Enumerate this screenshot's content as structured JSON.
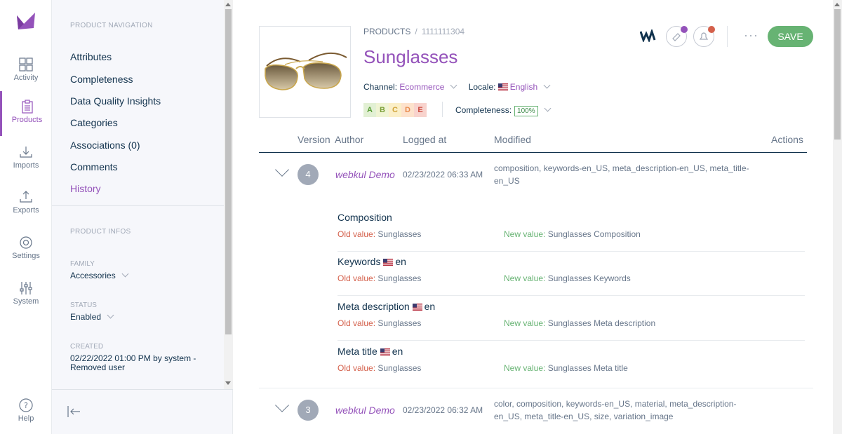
{
  "rail": {
    "items": [
      {
        "label": "Activity",
        "icon": "dashboard-icon"
      },
      {
        "label": "Products",
        "icon": "clipboard-icon"
      },
      {
        "label": "Imports",
        "icon": "import-icon"
      },
      {
        "label": "Exports",
        "icon": "export-icon"
      },
      {
        "label": "Settings",
        "icon": "gear-icon"
      },
      {
        "label": "System",
        "icon": "sliders-icon"
      }
    ],
    "help_label": "Help"
  },
  "product_nav": {
    "title": "PRODUCT NAVIGATION",
    "links": [
      "Attributes",
      "Completeness",
      "Data Quality Insights",
      "Categories",
      "Associations (0)",
      "Comments",
      "History"
    ],
    "active": "History",
    "infos_title": "PRODUCT INFOS",
    "family_label": "FAMILY",
    "family_value": "Accessories",
    "status_label": "STATUS",
    "status_value": "Enabled",
    "created_label": "CREATED",
    "created_value": "02/22/2022 01:00 PM by system - Removed user"
  },
  "header": {
    "breadcrumb_root": "PRODUCTS",
    "breadcrumb_id": "1111111304",
    "title": "Sunglasses",
    "channel_label": "Channel:",
    "channel_value": "Ecommerce",
    "locale_label": "Locale:",
    "locale_value": "English",
    "dqi_grades": [
      "A",
      "B",
      "C",
      "D",
      "E"
    ],
    "completeness_label": "Completeness:",
    "completeness_value": "100%",
    "save_label": "SAVE",
    "more_label": "···"
  },
  "history": {
    "columns": {
      "version": "Version",
      "author": "Author",
      "logged": "Logged at",
      "modified": "Modified",
      "actions": "Actions"
    },
    "old_label": "Old value:",
    "new_label": "New value:",
    "versions": [
      {
        "version": "4",
        "author": "webkul Demo",
        "logged": "02/23/2022 06:33 AM",
        "modified": "composition, keywords-en_US, meta_description-en_US, meta_title-en_US",
        "changes": [
          {
            "name": "Composition",
            "locale": "",
            "old": "Sunglasses",
            "new": "Sunglasses Composition"
          },
          {
            "name": "Keywords",
            "locale": "en",
            "old": "Sunglasses",
            "new": "Sunglasses Keywords"
          },
          {
            "name": "Meta description",
            "locale": "en",
            "old": "Sunglasses",
            "new": "Sunglasses Meta description"
          },
          {
            "name": "Meta title",
            "locale": "en",
            "old": "Sunglasses",
            "new": "Sunglasses Meta title"
          }
        ]
      },
      {
        "version": "3",
        "author": "webkul Demo",
        "logged": "02/23/2022 06:32 AM",
        "modified": "color, composition, keywords-en_US, material, meta_description-en_US, meta_title-en_US, size, variation_image",
        "changes": []
      }
    ]
  },
  "colors": {
    "accent": "#9452ba",
    "save": "#67b373",
    "old": "#d4604b",
    "new": "#67b373",
    "dot_purple": "#9452ba",
    "dot_red": "#d4604b"
  }
}
